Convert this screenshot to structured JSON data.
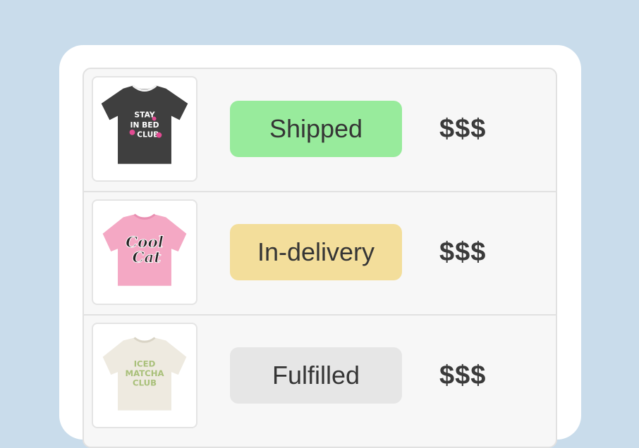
{
  "orders": [
    {
      "product": {
        "icon": "tshirt-black-icon",
        "print_lines": [
          "STAY",
          "IN BED",
          "CLUB"
        ]
      },
      "status": "Shipped",
      "status_color": "#98eb9c",
      "price": "$$$"
    },
    {
      "product": {
        "icon": "tshirt-pink-icon",
        "print_lines": [
          "Cool",
          "Cat"
        ]
      },
      "status": "In-delivery",
      "status_color": "#f3de9b",
      "price": "$$$"
    },
    {
      "product": {
        "icon": "tshirt-cream-icon",
        "print_lines": [
          "ICED",
          "MATCHA",
          "CLUB"
        ]
      },
      "status": "Fulfilled",
      "status_color": "#e6e6e6",
      "price": "$$$"
    }
  ],
  "colors": {
    "background": "#c9dceb",
    "card": "#ffffff",
    "table": "#f7f7f7",
    "shirt_black": "#3f3f3f",
    "shirt_pink": "#f4a8c4",
    "shirt_cream": "#eeeae0",
    "matcha_text": "#a9c07a"
  }
}
